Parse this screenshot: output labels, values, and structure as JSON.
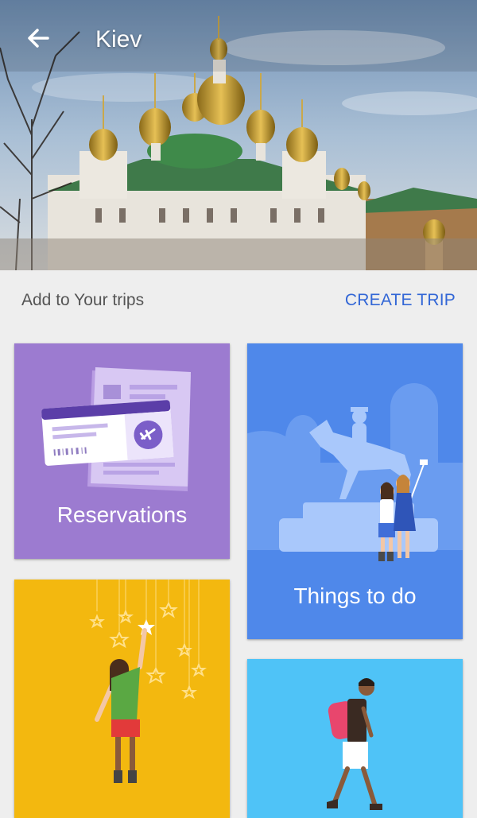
{
  "header": {
    "title": "Kiev",
    "back_icon": "arrow-back-icon"
  },
  "section": {
    "label": "Add to Your trips",
    "create_trip": "CREATE TRIP"
  },
  "cards": [
    {
      "label": "Reservations",
      "color": "#9c7bd0"
    },
    {
      "label": "Things to do",
      "color": "#4f88ea"
    },
    {
      "label": "",
      "color": "#f3b80f"
    },
    {
      "label": "",
      "color": "#4fc3f7"
    }
  ],
  "colors": {
    "accent": "#3367d6",
    "background": "#eeeeee"
  }
}
